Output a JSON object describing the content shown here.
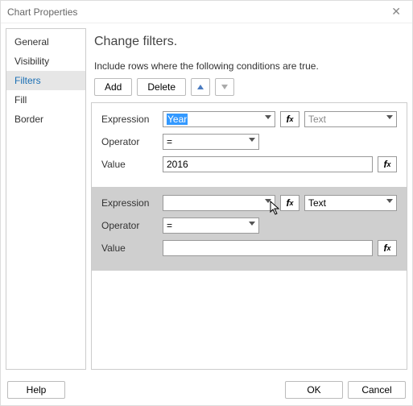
{
  "window": {
    "title": "Chart Properties"
  },
  "sidebar": {
    "items": [
      {
        "label": "General"
      },
      {
        "label": "Visibility"
      },
      {
        "label": "Filters",
        "selected": true
      },
      {
        "label": "Fill"
      },
      {
        "label": "Border"
      }
    ]
  },
  "page": {
    "title": "Change filters.",
    "subtitle": "Include rows where the following conditions are true."
  },
  "toolbar": {
    "add": "Add",
    "delete": "Delete",
    "move_up_icon": "arrow-up",
    "move_down_icon": "arrow-down"
  },
  "labels": {
    "expression": "Expression",
    "operator": "Operator",
    "value": "Value",
    "fx": "fx"
  },
  "filters": [
    {
      "selected": false,
      "expression": "Year",
      "expression_highlighted": true,
      "operator": "=",
      "value": "2016",
      "type": "Text"
    },
    {
      "selected": true,
      "expression": "",
      "expression_highlighted": false,
      "operator": "=",
      "value": "",
      "type": "Text"
    }
  ],
  "footer": {
    "help": "Help",
    "ok": "OK",
    "cancel": "Cancel"
  }
}
